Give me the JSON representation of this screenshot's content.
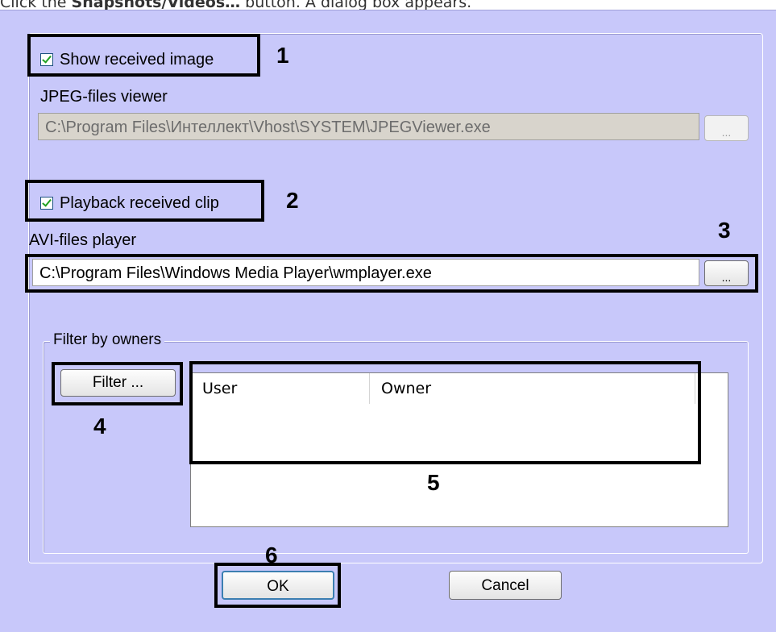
{
  "instruction": {
    "prefix": "Click the ",
    "button_name": "Snapshots/Videos…",
    "suffix": " button. A dialog box appears."
  },
  "dialog": {
    "show_image": {
      "label": "Show received image",
      "checked": true
    },
    "jpeg_viewer": {
      "label": "JPEG-files viewer",
      "value": "C:\\Program Files\\Интеллект\\Vhost\\SYSTEM\\JPEGViewer.exe",
      "browse_label": "..."
    },
    "playback_clip": {
      "label": "Playback received clip",
      "checked": true
    },
    "avi_player": {
      "label": "AVI-files player",
      "value": "C:\\Program Files\\Windows Media Player\\wmplayer.exe",
      "browse_label": "..."
    },
    "filter_group": {
      "legend": "Filter by owners",
      "filter_button": "Filter ...",
      "columns": [
        "User",
        "Owner"
      ]
    },
    "ok_button": "OK",
    "cancel_button": "Cancel"
  },
  "annotations": [
    "1",
    "2",
    "3",
    "4",
    "5",
    "6"
  ],
  "colors": {
    "dialog_bg": "#c8c8fa",
    "check": "#21a121",
    "annotation": "#000000"
  }
}
